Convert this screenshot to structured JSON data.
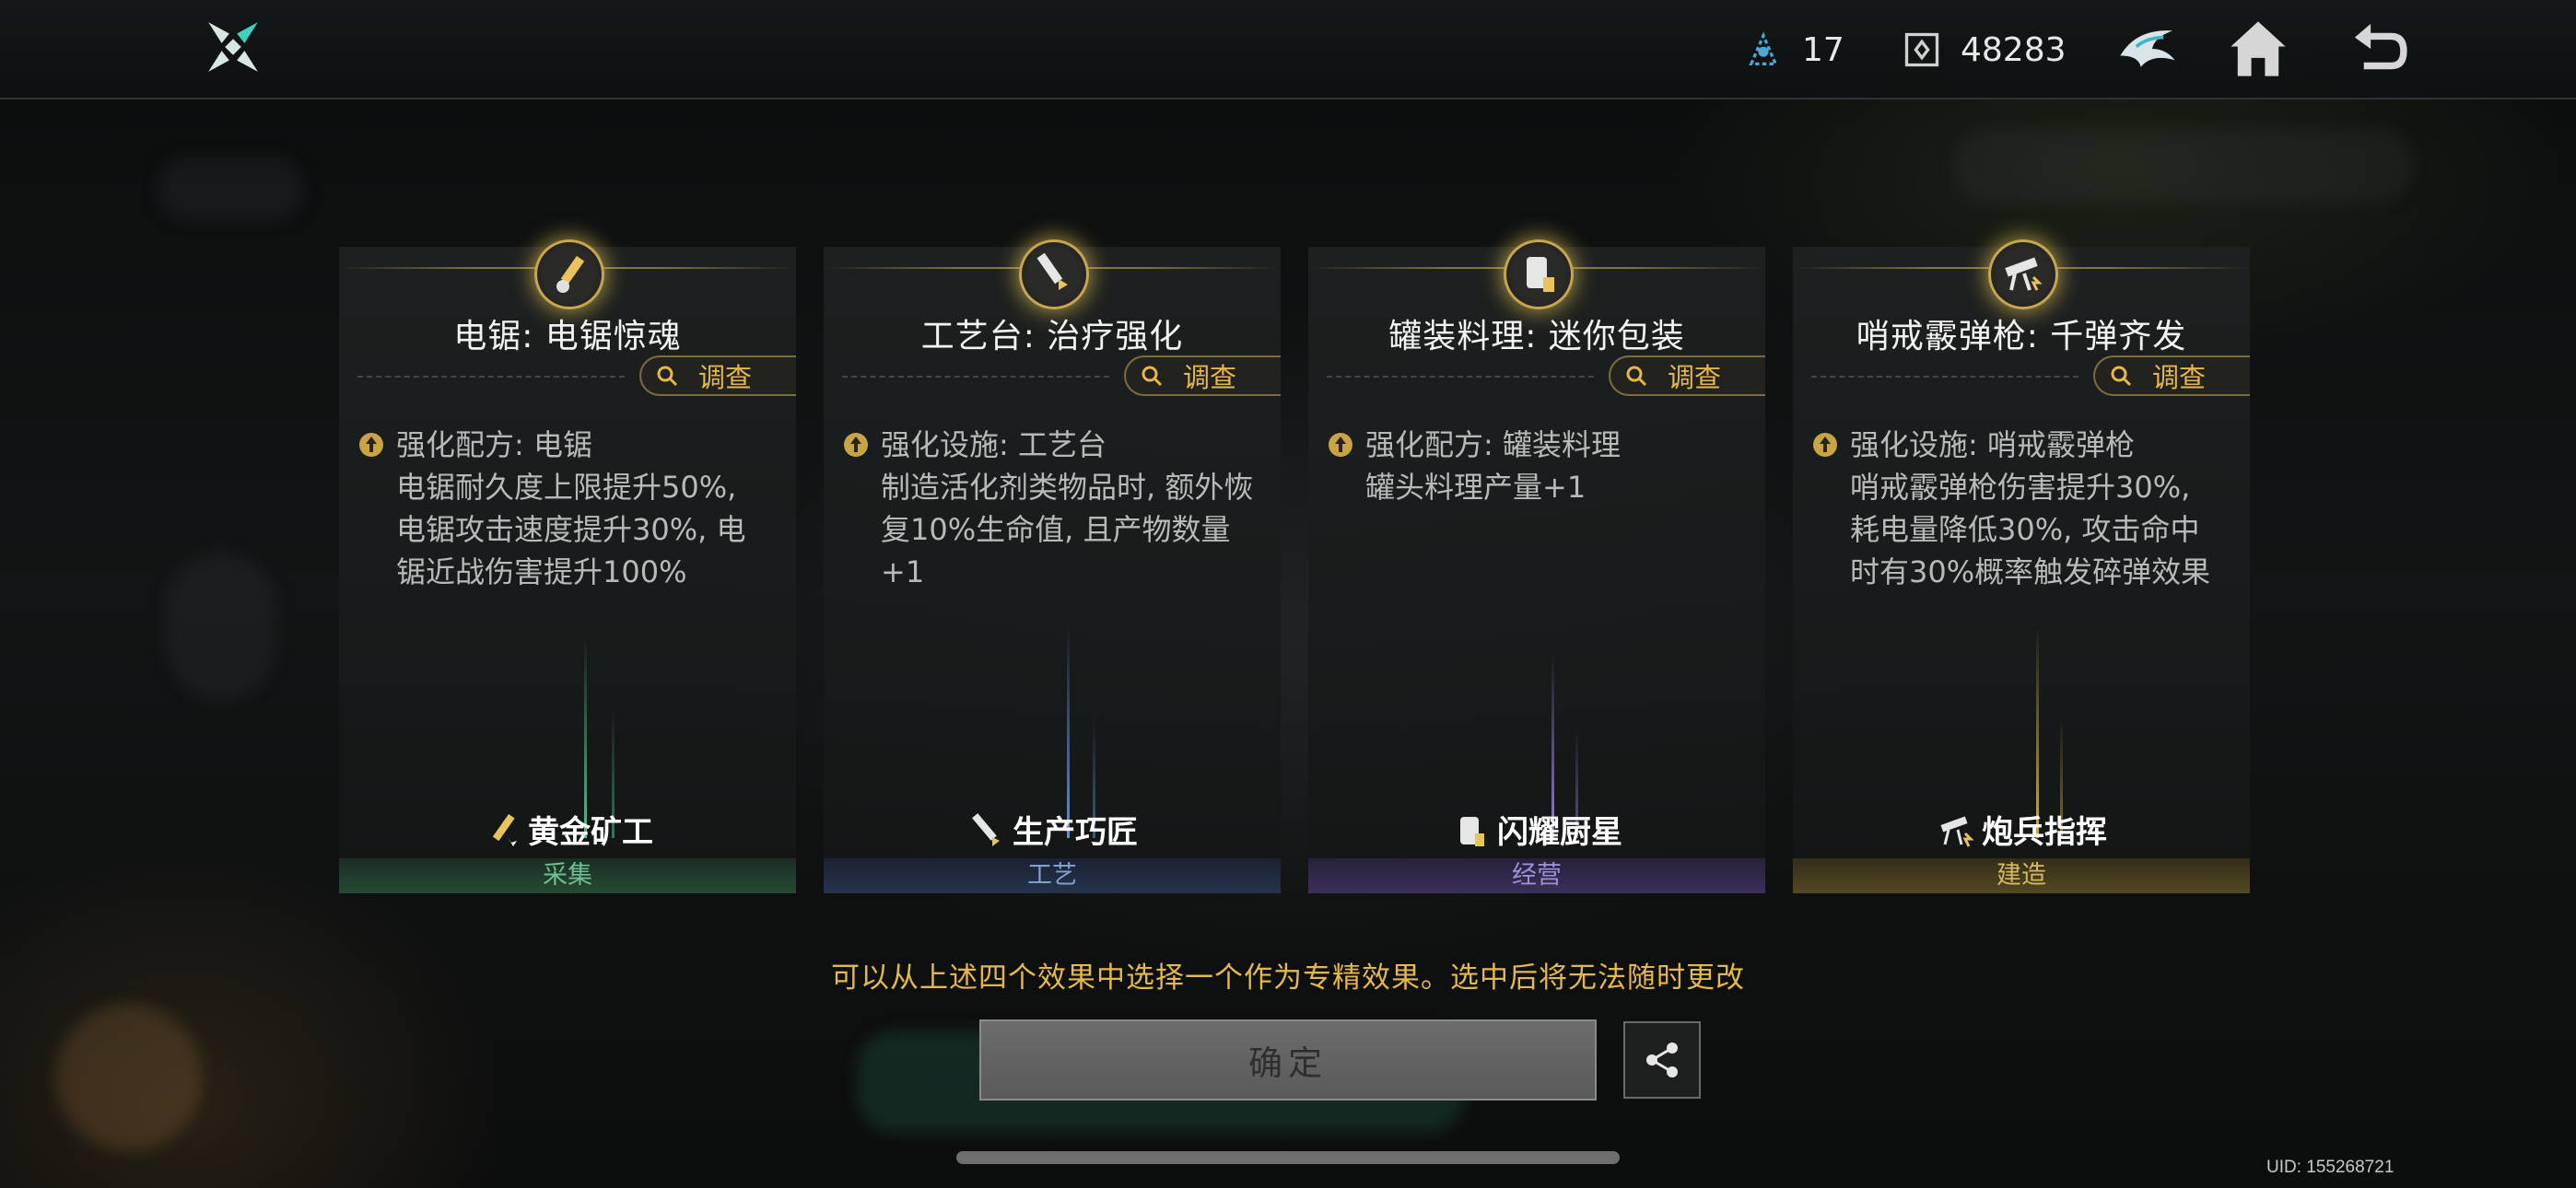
{
  "header": {
    "resources": [
      {
        "icon": "energy-crystal-icon",
        "value": "17"
      },
      {
        "icon": "chip-currency-icon",
        "value": "48283"
      }
    ],
    "icons": [
      "guild-emblem-icon",
      "home-icon",
      "back-arrow-icon"
    ]
  },
  "cards": [
    {
      "title": "电锯: 电锯惊魂",
      "investigate": "调查",
      "desc_head": "强化配方: 电锯",
      "desc_body": "电锯耐久度上限提升50%, 电锯攻击速度提升30%, 电锯近战伤害提升100%",
      "role": "黄金矿工",
      "category": "采集",
      "accent": "#5fcf9a"
    },
    {
      "title": "工艺台: 治疗强化",
      "investigate": "调查",
      "desc_head": "强化设施: 工艺台",
      "desc_body": "制造活化剂类物品时, 额外恢复10%生命值, 且产物数量+1",
      "role": "生产巧匠",
      "category": "工艺",
      "accent": "#6f9fe0"
    },
    {
      "title": "罐装料理: 迷你包装",
      "investigate": "调查",
      "desc_head": "强化配方: 罐装料理",
      "desc_body": "罐头料理产量+1",
      "role": "闪耀厨星",
      "category": "经营",
      "accent": "#a48ae6"
    },
    {
      "title": "哨戒霰弹枪: 千弹齐发",
      "investigate": "调查",
      "desc_head": "强化设施: 哨戒霰弹枪",
      "desc_body": "哨戒霰弹枪伤害提升30%, 耗电量降低30%, 攻击命中时有30%概率触发碎弹效果",
      "role": "炮兵指挥",
      "category": "建造",
      "accent": "#e0c05a"
    }
  ],
  "hint": "可以从上述四个效果中选择一个作为专精效果。选中后将无法随时更改",
  "confirm_label": "确定",
  "uid": "UID: 155268721"
}
